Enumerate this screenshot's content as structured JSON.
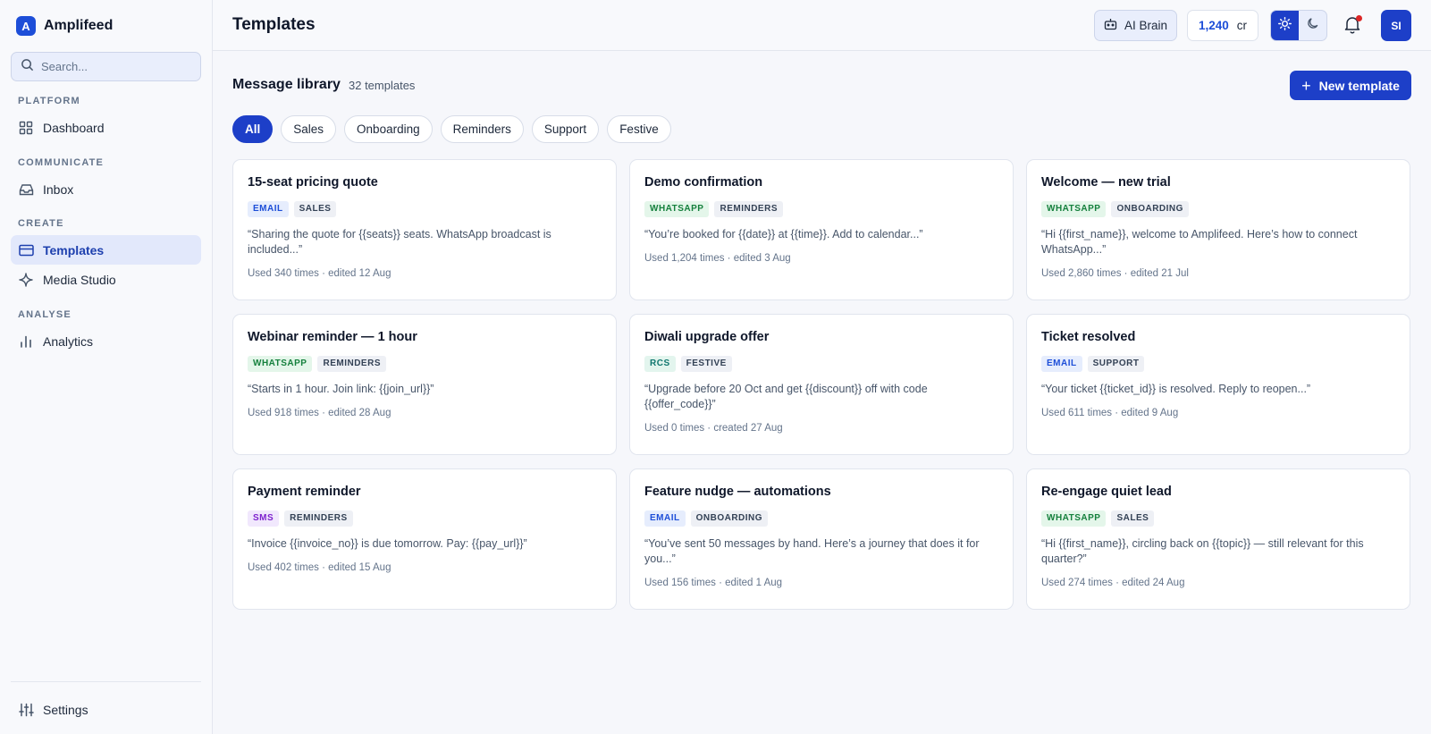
{
  "brand": {
    "logo_letter": "A",
    "name": "Amplifeed"
  },
  "search": {
    "placeholder": "Search..."
  },
  "sidebar": {
    "sections": [
      {
        "label": "PLATFORM",
        "items": [
          {
            "label": "Dashboard",
            "icon": "dashboard-icon"
          }
        ]
      },
      {
        "label": "COMMUNICATE",
        "items": [
          {
            "label": "Inbox",
            "icon": "inbox-icon"
          }
        ]
      },
      {
        "label": "CREATE",
        "items": [
          {
            "label": "Templates",
            "icon": "templates-icon",
            "active": true
          },
          {
            "label": "Media Studio",
            "icon": "sparkle-icon"
          }
        ]
      },
      {
        "label": "ANALYSE",
        "items": [
          {
            "label": "Analytics",
            "icon": "bar-chart-icon"
          }
        ]
      }
    ],
    "settings_label": "Settings"
  },
  "header": {
    "title": "Templates",
    "ai_brain_label": "AI Brain",
    "credits_value": "1,240",
    "credits_unit": "cr",
    "theme": "light",
    "avatar_initials": "SI"
  },
  "library": {
    "title": "Message library",
    "count": "32 templates",
    "new_button_label": "New template",
    "filters": [
      "All",
      "Sales",
      "Onboarding",
      "Reminders",
      "Support",
      "Festive"
    ],
    "active_filter": "All"
  },
  "templates": [
    {
      "title": "15-seat pricing quote",
      "channel": "EMAIL",
      "category": "SALES",
      "preview": "“Sharing the quote for {{seats}} seats. WhatsApp broadcast is included...”",
      "meta": "Used 340 times · edited 12 Aug"
    },
    {
      "title": "Demo confirmation",
      "channel": "WHATSAPP",
      "category": "REMINDERS",
      "preview": "“You’re booked for {{date}} at {{time}}. Add to calendar...”",
      "meta": "Used 1,204 times · edited 3 Aug"
    },
    {
      "title": "Welcome — new trial",
      "channel": "WHATSAPP",
      "category": "ONBOARDING",
      "preview": "“Hi {{first_name}}, welcome to Amplifeed. Here’s how to connect WhatsApp...”",
      "meta": "Used 2,860 times · edited 21 Jul"
    },
    {
      "title": "Webinar reminder — 1 hour",
      "channel": "WHATSAPP",
      "category": "REMINDERS",
      "preview": "“Starts in 1 hour. Join link: {{join_url}}”",
      "meta": "Used 918 times · edited 28 Aug"
    },
    {
      "title": "Diwali upgrade offer",
      "channel": "RCS",
      "category": "FESTIVE",
      "preview": "“Upgrade before 20 Oct and get {{discount}} off with code {{offer_code}}”",
      "meta": "Used 0 times · created 27 Aug"
    },
    {
      "title": "Ticket resolved",
      "channel": "EMAIL",
      "category": "SUPPORT",
      "preview": "“Your ticket {{ticket_id}} is resolved. Reply to reopen...”",
      "meta": "Used 611 times · edited 9 Aug"
    },
    {
      "title": "Payment reminder",
      "channel": "SMS",
      "category": "REMINDERS",
      "preview": "“Invoice {{invoice_no}} is due tomorrow. Pay: {{pay_url}}”",
      "meta": "Used 402 times · edited 15 Aug"
    },
    {
      "title": "Feature nudge — automations",
      "channel": "EMAIL",
      "category": "ONBOARDING",
      "preview": "“You’ve sent 50 messages by hand. Here’s a journey that does it for you...”",
      "meta": "Used 156 times · edited 1 Aug"
    },
    {
      "title": "Re-engage quiet lead",
      "channel": "WHATSAPP",
      "category": "SALES",
      "preview": "“Hi {{first_name}}, circling back on {{topic}} — still relevant for this quarter?”",
      "meta": "Used 274 times · edited 24 Aug"
    }
  ],
  "colors": {
    "accent": "#1d3fc8",
    "email": "#1d4ed8",
    "whatsapp": "#15803d",
    "rcs": "#0f766e",
    "sms": "#7e22ce",
    "notification_dot": "#dc2626"
  }
}
